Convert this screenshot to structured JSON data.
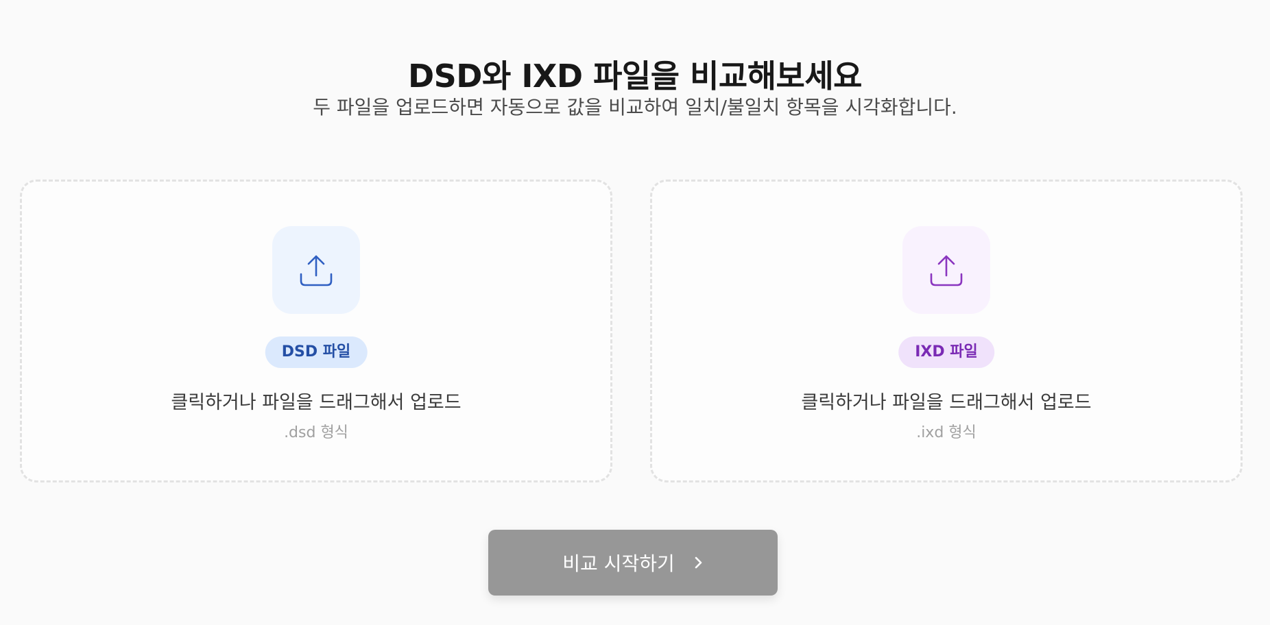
{
  "header": {
    "title": "DSD와 IXD 파일을 비교해보세요",
    "subtitle": "두 파일을 업로드하면 자동으로 값을 비교하여 일치/불일치 항목을 시각화합니다."
  },
  "upload_cards": [
    {
      "badge": "DSD 파일",
      "hint": "클릭하거나 파일을 드래그해서 업로드",
      "format": ".dsd 형식",
      "accent": "#2f5fc2",
      "icon": "upload-icon"
    },
    {
      "badge": "IXD 파일",
      "hint": "클릭하거나 파일을 드래그해서 업로드",
      "format": ".ixd 형식",
      "accent": "#8a35bf",
      "icon": "upload-icon"
    }
  ],
  "action": {
    "compare_label": "비교 시작하기",
    "icon": "chevron-right-icon",
    "disabled": true
  }
}
